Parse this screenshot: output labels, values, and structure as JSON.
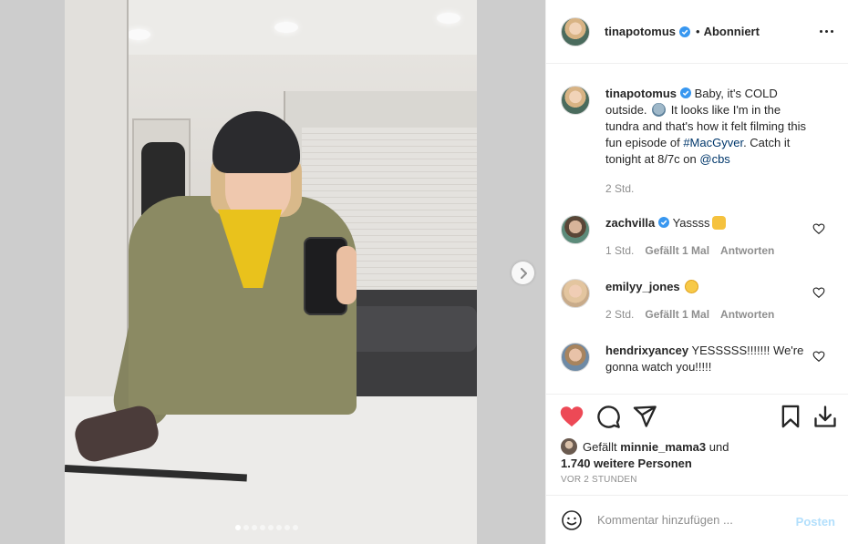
{
  "colors": {
    "accent_blue": "#0095f6",
    "like_red": "#ed4956",
    "text": "#262626",
    "muted": "#8e8e8e",
    "post_disabled": "#b2dffc"
  },
  "media": {
    "carousel_count": 8,
    "carousel_active": 1,
    "next_icon": "chevron-right-icon"
  },
  "post_header": {
    "username": "tinapotomus",
    "separator": "•",
    "follow_status": "Abonniert",
    "more_icon": "more-options-icon"
  },
  "caption": {
    "username": "tinapotomus",
    "text_part1": "Baby, it's COLD outside.",
    "text_part2": "It looks like I'm in the tundra and that's how it felt filming this fun episode of",
    "hashtag": "#MacGyver",
    "text_part3": ". Catch it tonight at 8/7c on",
    "mention": "@cbs",
    "time": "2 Std."
  },
  "comments": [
    {
      "username": "zachvilla",
      "verified": true,
      "text": "Yassss",
      "emoji": "hands-emoji",
      "time": "1 Std.",
      "likes": "Gefällt 1 Mal",
      "reply": "Antworten"
    },
    {
      "username": "emilyy_jones",
      "verified": false,
      "text": "",
      "emoji": "heart-eyes-emoji",
      "time": "2 Std.",
      "likes": "Gefällt 1 Mal",
      "reply": "Antworten"
    },
    {
      "username": "hendrixyancey",
      "verified": false,
      "text": "YESSSSS!!!!!!! We're gonna watch you!!!!!",
      "emoji": "",
      "time": "",
      "likes": "",
      "reply": ""
    }
  ],
  "actions": {
    "like_icon": "heart-filled-icon",
    "comment_icon": "comment-icon",
    "share_icon": "share-icon",
    "save_icon": "bookmark-icon",
    "download_icon": "download-icon"
  },
  "likes": {
    "prefix": "Gefällt",
    "user": "minnie_mama3",
    "and": "und",
    "others": "1.740 weitere Personen"
  },
  "posted_ago": "VOR 2 STUNDEN",
  "comment_form": {
    "placeholder": "Kommentar hinzufügen ...",
    "post_label": "Posten",
    "emoji_icon": "smiley-icon"
  }
}
